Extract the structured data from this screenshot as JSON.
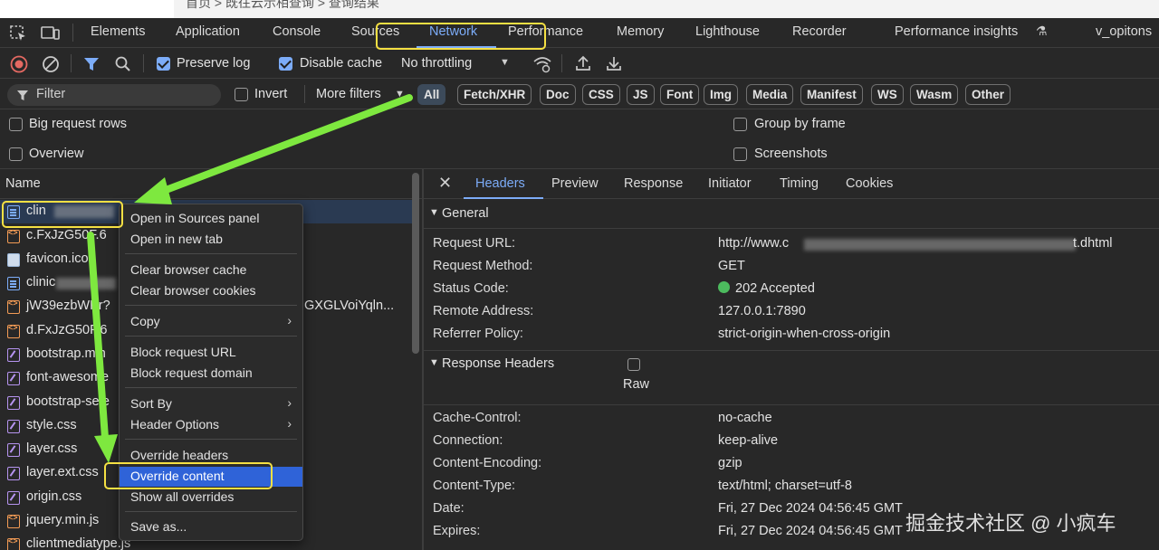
{
  "breadcrumb": "首页 > 既往云示相查询 > 查询结果",
  "devtools_tabs": [
    "Elements",
    "Application",
    "Console",
    "Sources",
    "Network",
    "Performance",
    "Memory",
    "Lighthouse",
    "Recorder",
    "Performance insights",
    "v_opitons"
  ],
  "active_tab": "Network",
  "toolbar": {
    "preserve_log": "Preserve log",
    "disable_cache": "Disable cache",
    "throttling": "No throttling"
  },
  "filter": {
    "placeholder": "Filter",
    "invert": "Invert",
    "more_filters": "More filters",
    "chips": [
      "All",
      "Fetch/XHR",
      "Doc",
      "CSS",
      "JS",
      "Font",
      "Img",
      "Media",
      "Manifest",
      "WS",
      "Wasm",
      "Other"
    ]
  },
  "options": {
    "big_request_rows": "Big request rows",
    "group_by_frame": "Group by frame",
    "overview": "Overview",
    "screenshots": "Screenshots"
  },
  "request_list": {
    "header": "Name",
    "rows": [
      {
        "name": "clin",
        "type": "doc"
      },
      {
        "name": "c.FxJzG50F.6",
        "type": "js"
      },
      {
        "name": "favicon.ico",
        "type": "img"
      },
      {
        "name": "clinic",
        "type": "doc"
      },
      {
        "name": "jW39ezbWPr?",
        "type": "js"
      },
      {
        "name": "d.FxJzG50F.6",
        "type": "js"
      },
      {
        "name": "bootstrap.min",
        "type": "css"
      },
      {
        "name": "font-awesome",
        "type": "css"
      },
      {
        "name": "bootstrap-sele",
        "type": "css"
      },
      {
        "name": "style.css",
        "type": "css"
      },
      {
        "name": "layer.css",
        "type": "css"
      },
      {
        "name": "layer.ext.css",
        "type": "css"
      },
      {
        "name": "origin.css",
        "type": "css"
      },
      {
        "name": "jquery.min.js",
        "type": "js"
      },
      {
        "name": "clientmediatype.js",
        "type": "js"
      }
    ],
    "row_extra": "GXGLVoiYqln..."
  },
  "context_menu": {
    "items": [
      "Open in Sources panel",
      "Open in new tab",
      "Clear browser cache",
      "Clear browser cookies",
      "Copy",
      "Block request URL",
      "Block request domain",
      "Sort By",
      "Header Options",
      "Override headers",
      "Override content",
      "Show all overrides",
      "Save as..."
    ],
    "highlighted": "Override content"
  },
  "detail_tabs": [
    "Headers",
    "Preview",
    "Response",
    "Initiator",
    "Timing",
    "Cookies"
  ],
  "general": {
    "title": "General",
    "rows": [
      {
        "k": "Request URL:",
        "v": "http://www.c",
        "v_end": "t.dhtml"
      },
      {
        "k": "Request Method:",
        "v": "GET"
      },
      {
        "k": "Status Code:",
        "v": "202 Accepted"
      },
      {
        "k": "Remote Address:",
        "v": "127.0.0.1:7890"
      },
      {
        "k": "Referrer Policy:",
        "v": "strict-origin-when-cross-origin"
      }
    ]
  },
  "response_headers": {
    "title": "Response Headers",
    "raw": "Raw",
    "rows": [
      {
        "k": "Cache-Control:",
        "v": "no-cache"
      },
      {
        "k": "Connection:",
        "v": "keep-alive"
      },
      {
        "k": "Content-Encoding:",
        "v": "gzip"
      },
      {
        "k": "Content-Type:",
        "v": "text/html; charset=utf-8"
      },
      {
        "k": "Date:",
        "v": "Fri, 27 Dec 2024 04:56:45 GMT"
      },
      {
        "k": "Expires:",
        "v": "Fri, 27 Dec 2024 04:56:45 GMT"
      }
    ]
  },
  "watermark": "掘金技术社区 @ 小疯车",
  "colors": {
    "accent": "#7cacf8",
    "highlight_box": "#f5e043",
    "arrow": "#7ee83f",
    "menu_highlight": "#2f63d8"
  }
}
